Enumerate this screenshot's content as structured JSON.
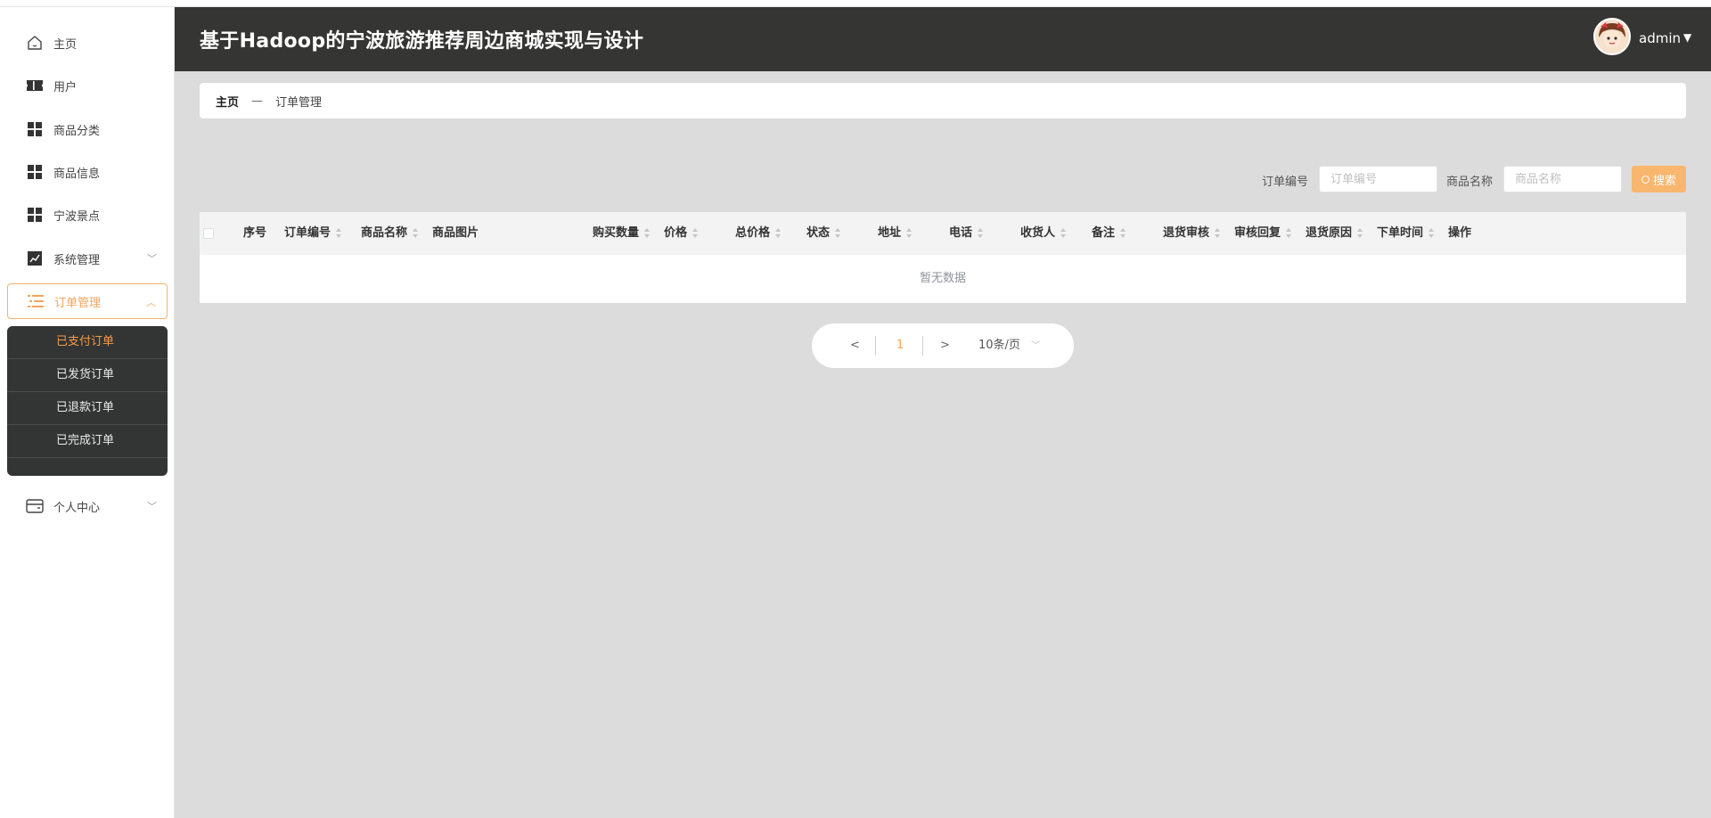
{
  "app": {
    "title": "基于Hadoop的宁波旅游推荐周边商城实现与设计"
  },
  "user": {
    "name": "admin"
  },
  "sidebar": {
    "items": [
      {
        "label": "主页",
        "icon": "home-icon"
      },
      {
        "label": "用户",
        "icon": "ticket-icon"
      },
      {
        "label": "商品分类",
        "icon": "grid-icon"
      },
      {
        "label": "商品信息",
        "icon": "grid-icon"
      },
      {
        "label": "宁波景点",
        "icon": "grid-icon"
      },
      {
        "label": "系统管理",
        "icon": "trend-chart-icon",
        "expandable": true
      },
      {
        "label": "订单管理",
        "icon": "list-icon",
        "expandable": true,
        "active": true
      },
      {
        "label": "个人中心",
        "icon": "wallet-icon",
        "expandable": true
      }
    ],
    "order_submenu": [
      {
        "label": "已支付订单",
        "active": true
      },
      {
        "label": "已发货订单"
      },
      {
        "label": "已退款订单"
      },
      {
        "label": "已完成订单"
      }
    ]
  },
  "breadcrumb": {
    "home": "主页",
    "separator": "—",
    "current": "订单管理"
  },
  "search": {
    "order_no_label": "订单编号",
    "order_no_placeholder": "订单编号",
    "product_name_label": "商品名称",
    "product_name_placeholder": "商品名称",
    "button_label": "搜索"
  },
  "table": {
    "columns": [
      "序号",
      "订单编号",
      "商品名称",
      "商品图片",
      "购买数量",
      "价格",
      "总价格",
      "状态",
      "地址",
      "电话",
      "收货人",
      "备注",
      "退货审核",
      "审核回复",
      "退货原因",
      "下单时间",
      "操作"
    ],
    "empty_text": "暂无数据"
  },
  "pagination": {
    "prev": "<",
    "current_page": "1",
    "next": ">",
    "page_size": "10条/页"
  },
  "colors": {
    "accent": "#f8b66f",
    "header_bg": "#353634",
    "submenu_bg": "#333534",
    "content_bg": "#dcdcdc"
  }
}
